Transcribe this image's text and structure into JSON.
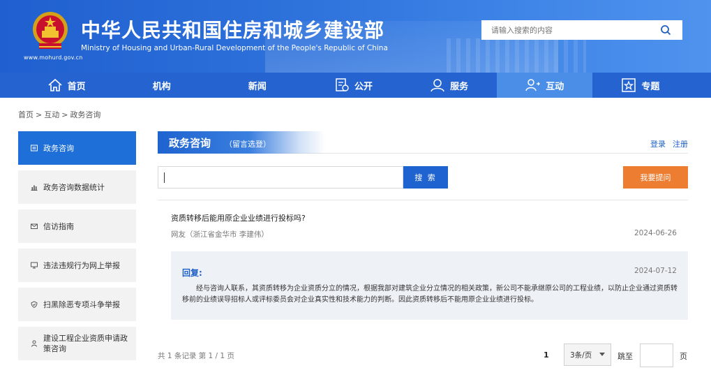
{
  "header": {
    "title": "中华人民共和国住房和城乡建设部",
    "subtitle_en": "Ministry of Housing and Urban-Rural Development of the People's Republic of China",
    "site_url": "www.mohurd.gov.cn",
    "search_placeholder": "请输入搜索的内容",
    "search_icon": "search-icon"
  },
  "nav": {
    "items": [
      {
        "label": "首页",
        "icon": "home-icon"
      },
      {
        "label": "机构",
        "icon": ""
      },
      {
        "label": "新闻",
        "icon": ""
      },
      {
        "label": "公开",
        "icon": "document-icon"
      },
      {
        "label": "服务",
        "icon": "service-icon"
      },
      {
        "label": "互动",
        "icon": "interaction-icon"
      },
      {
        "label": "专题",
        "icon": "star-icon"
      }
    ],
    "active_index": 5
  },
  "breadcrumb": [
    "首页",
    "互动",
    "政务咨询"
  ],
  "sidebar": {
    "items": [
      {
        "label": "政务咨询",
        "icon": "message-icon",
        "active": true
      },
      {
        "label": "政务咨询数据统计",
        "icon": "bar-chart-icon",
        "active": false
      },
      {
        "label": "信访指南",
        "icon": "mail-icon",
        "active": false
      },
      {
        "label": "违法违规行为网上举报",
        "icon": "monitor-icon",
        "active": false
      },
      {
        "label": "扫黑除恶专项斗争举报",
        "icon": "shield-icon",
        "active": false
      },
      {
        "label": "建设工程企业资质申请政策咨询",
        "icon": "person-icon",
        "active": false
      }
    ]
  },
  "main": {
    "title": "政务咨询",
    "title_sub": "（留言选登）",
    "login_label": "登录",
    "register_label": "注册",
    "search_value": "",
    "search_button": "搜 索",
    "ask_button": "我要提问",
    "question": {
      "title": "资质转移后能用原企业业绩进行投标吗?",
      "user": "网友（浙江省金华市 李建伟）",
      "date": "2024-06-26"
    },
    "reply": {
      "label": "回复:",
      "date": "2024-07-12",
      "text": "经与咨询人联系，其资质转移为企业资质分立的情况，根据我部对建筑企业分立情况的相关政策，新公司不能承继原公司的工程业绩，以防止企业通过资质转移前的业绩误导招标人或评标委员会对企业真实性和技术能力的判断。因此资质转移后不能用原企业业绩进行投标。"
    },
    "pager": {
      "summary": "共 1 条记录 第 1 / 1 页",
      "current_page": "1",
      "per_page": "3条/页",
      "jump_label": "跳至",
      "page_unit": "页"
    }
  },
  "colors": {
    "primary": "#1e63cf",
    "nav_active": "#4a8ee8",
    "ask_button": "#ed7d31",
    "link": "#1e5fc6"
  }
}
